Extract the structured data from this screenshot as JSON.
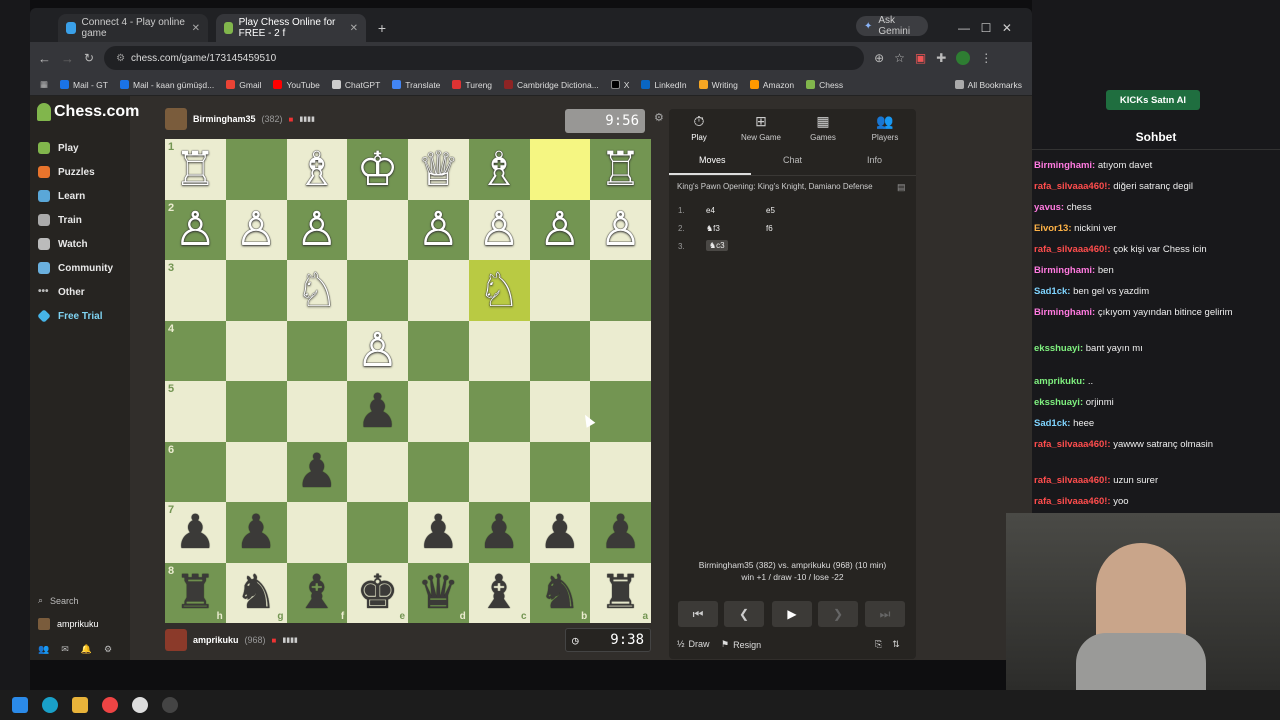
{
  "browser": {
    "tabs": [
      {
        "label": "Connect 4 - Play online game"
      },
      {
        "label": "Play Chess Online for FREE - 2 f"
      }
    ],
    "new_tab": "+",
    "ask_gemini": "Ask Gemini",
    "url": "chess.com/game/173145459510",
    "bookmarks": [
      "Mail - GT",
      "Mail - kaan gümüşd...",
      "Gmail",
      "YouTube",
      "ChatGPT",
      "Translate",
      "Tureng",
      "Cambridge Dictiona...",
      "X",
      "LinkedIn",
      "Writing",
      "Amazon",
      "Chess"
    ],
    "all_bookmarks": "All Bookmarks"
  },
  "site": {
    "logo": "Chess.com",
    "nav": [
      "Play",
      "Puzzles",
      "Learn",
      "Train",
      "Watch",
      "Community",
      "Other",
      "Free Trial"
    ],
    "search": "Search",
    "username": "amprikuku"
  },
  "top_player": {
    "name": "Birmingham35",
    "rating": "(382)",
    "clock": "9:56"
  },
  "bottom_player": {
    "name": "amprikuku",
    "rating": "(968)",
    "clock": "9:38"
  },
  "board": {
    "ranks": [
      "1",
      "2",
      "3",
      "4",
      "5",
      "6",
      "7",
      "8"
    ],
    "files": [
      "h",
      "g",
      "f",
      "e",
      "d",
      "c",
      "b",
      "a"
    ],
    "rows": [
      [
        "wR",
        "",
        "wB",
        "wK",
        "wQ",
        "wB",
        "",
        "wR"
      ],
      [
        "wP",
        "wP",
        "wP",
        "",
        "wP",
        "wP",
        "wP",
        "wP"
      ],
      [
        "",
        "",
        "wN",
        "",
        "",
        "wN",
        "",
        ""
      ],
      [
        "",
        "",
        "",
        "wP",
        "",
        "",
        "",
        ""
      ],
      [
        "",
        "",
        "",
        "bP",
        "",
        "",
        "",
        ""
      ],
      [
        "",
        "",
        "bP",
        "",
        "",
        "",
        "",
        ""
      ],
      [
        "bP",
        "bP",
        "",
        "",
        "bP",
        "bP",
        "bP",
        "bP"
      ],
      [
        "bR",
        "bN",
        "bB",
        "bK",
        "bQ",
        "bB",
        "bN",
        "bR"
      ]
    ],
    "highlight": [
      [
        0,
        6
      ],
      [
        2,
        5
      ]
    ]
  },
  "panel": {
    "tabs": [
      "Play",
      "New Game",
      "Games",
      "Players"
    ],
    "subtabs": [
      "Moves",
      "Chat",
      "Info"
    ],
    "opening": "King's Pawn Opening: King's Knight, Damiano Defense",
    "moves": [
      {
        "n": "1.",
        "w": "e4",
        "b": "e5"
      },
      {
        "n": "2.",
        "w": "♞f3",
        "b": "f6"
      },
      {
        "n": "3.",
        "w": "♞c3",
        "b": ""
      }
    ],
    "summary_line1": "Birmingham35 (382) vs. amprikuku (968) (10 min)",
    "summary_line2": "win +1 / draw -10 / lose -22",
    "draw": "Draw",
    "resign": "Resign",
    "half": "½"
  },
  "stream_chat": {
    "header": "Sohbet",
    "kicks": "KICKs Satın Al",
    "lines": [
      {
        "user": "Birminghami:",
        "color": "#ff7ae0",
        "text": "atıyom davet"
      },
      {
        "user": "rafa_silvaaa460!:",
        "color": "#ff4d4d",
        "text": "diğeri satranç degil"
      },
      {
        "user": "yavus:",
        "color": "#ff7ae0",
        "text": "chess"
      },
      {
        "user": "Eivor13:",
        "color": "#ffb347",
        "text": "nickini ver"
      },
      {
        "user": "rafa_silvaaa460!:",
        "color": "#ff4d4d",
        "text": "çok kişi var Chess icin"
      },
      {
        "user": "Birminghami:",
        "color": "#ff7ae0",
        "text": "ben"
      },
      {
        "user": "Sad1ck:",
        "color": "#7fd4ff",
        "text": "ben gel vs yazdim"
      },
      {
        "user": "Birminghami:",
        "color": "#ff7ae0",
        "text": "çıkıyom yayından bitince gelirim"
      },
      {
        "user": "eksshuayi:",
        "color": "#7ff07f",
        "text": "bant yayın mı"
      },
      {
        "user": "amprikuku:",
        "color": "#7ff07f",
        "text": ".."
      },
      {
        "user": "eksshuayi:",
        "color": "#7ff07f",
        "text": "orjinmi"
      },
      {
        "user": "Sad1ck:",
        "color": "#7fd4ff",
        "text": "heee"
      },
      {
        "user": "rafa_silvaaa460!:",
        "color": "#ff4d4d",
        "text": "yawww satranç olmasin"
      },
      {
        "user": "rafa_silvaaa460!:",
        "color": "#ff4d4d",
        "text": "uzun surer"
      },
      {
        "user": "rafa_silvaaa460!:",
        "color": "#ff4d4d",
        "text": "yoo"
      }
    ]
  }
}
